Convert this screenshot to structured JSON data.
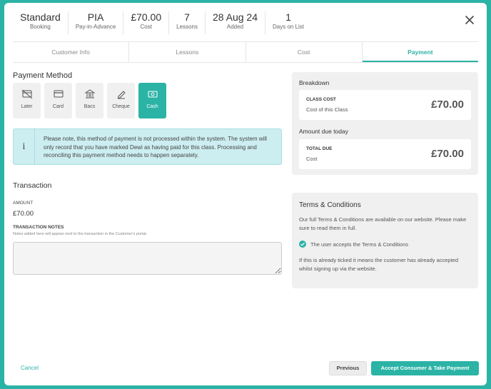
{
  "header": {
    "stats": [
      {
        "value": "Standard",
        "label": "Booking"
      },
      {
        "value": "PIA",
        "label": "Pay-in-Advance"
      },
      {
        "value": "£70.00",
        "label": "Cost"
      },
      {
        "value": "7",
        "label": "Lessons"
      },
      {
        "value": "28 Aug 24",
        "label": "Added"
      },
      {
        "value": "1",
        "label": "Days on List"
      }
    ],
    "close_icon": "close-icon"
  },
  "tabs": [
    {
      "label": "Customer Info",
      "active": false
    },
    {
      "label": "Lessons",
      "active": false
    },
    {
      "label": "Cost",
      "active": false
    },
    {
      "label": "Payment",
      "active": true
    }
  ],
  "payment_method": {
    "title": "Payment Method",
    "options": [
      {
        "label": "Later",
        "icon": "card-off-icon",
        "selected": false
      },
      {
        "label": "Card",
        "icon": "credit-card-icon",
        "selected": false
      },
      {
        "label": "Bacs",
        "icon": "bank-icon",
        "selected": false
      },
      {
        "label": "Cheque",
        "icon": "pen-icon",
        "selected": false
      },
      {
        "label": "Cash",
        "icon": "cash-icon",
        "selected": true
      }
    ],
    "notice_icon": "i",
    "notice": "Please note, this method of payment is not processed within the system. The system will only record that you have marked Dewi as having paid for this class. Processing and reconciling this payment method needs to happen separately."
  },
  "transaction": {
    "title": "Transaction",
    "amount_label": "AMOUNT",
    "amount_value": "£70.00",
    "notes_label": "TRANSACTION NOTES",
    "notes_help": "Notes added here will appear next to the transaction in the Customer's portal.",
    "notes_value": ""
  },
  "breakdown": {
    "title": "Breakdown",
    "class_cost": {
      "label": "CLASS COST",
      "sub": "Cost of this Class",
      "value": "£70.00"
    },
    "due_title": "Amount due today",
    "total_due": {
      "label": "TOTAL DUE",
      "sub": "Cost",
      "value": "£70.00"
    }
  },
  "terms": {
    "title": "Terms & Conditions",
    "text": "Our full Terms & Conditions are available on our website. Please make sure to read them in full.",
    "checkbox_label": "The user accepts the Terms & Conditions",
    "checked": true,
    "note": "If this is already ticked it means the customer has already accepted whilst signing up via the website."
  },
  "footer": {
    "cancel": "Cancel",
    "previous": "Previous",
    "accept": "Accept Consumer & Take Payment"
  },
  "colors": {
    "accent": "#2bb3a6",
    "notice_bg": "#cdeef0",
    "panel_bg": "#f0f0f0"
  }
}
